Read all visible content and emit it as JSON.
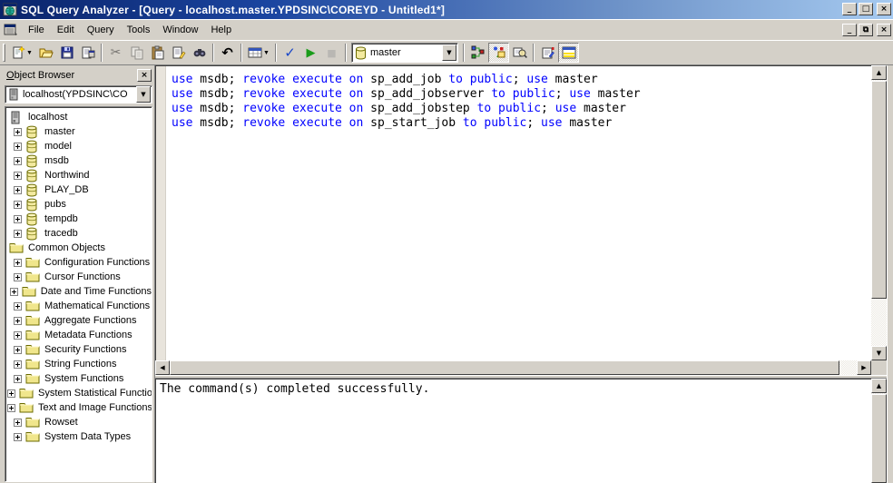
{
  "window": {
    "title": "SQL Query Analyzer - [Query - localhost.master.YPDSINC\\COREYD - Untitled1*]",
    "controls": {
      "minimize": "_",
      "maximize": "□",
      "close": "×",
      "restore": "⧉"
    }
  },
  "menu": {
    "items": [
      "File",
      "Edit",
      "Query",
      "Tools",
      "Window",
      "Help"
    ]
  },
  "toolbar": {
    "buttons": [
      {
        "name": "new-query",
        "dropdown": true,
        "disabled": false,
        "pressed": false
      },
      {
        "name": "open",
        "disabled": false,
        "pressed": false
      },
      {
        "name": "save",
        "disabled": false,
        "pressed": false
      },
      {
        "name": "insert-template",
        "disabled": false,
        "pressed": false
      },
      {
        "name": "sep"
      },
      {
        "name": "cut",
        "disabled": true,
        "pressed": false
      },
      {
        "name": "copy",
        "disabled": true,
        "pressed": false
      },
      {
        "name": "paste",
        "disabled": false,
        "pressed": false
      },
      {
        "name": "clear-window",
        "disabled": false,
        "pressed": false
      },
      {
        "name": "find",
        "disabled": false,
        "pressed": false
      },
      {
        "name": "sep"
      },
      {
        "name": "undo",
        "disabled": false,
        "pressed": false
      },
      {
        "name": "sep"
      },
      {
        "name": "execute-mode",
        "dropdown": true,
        "disabled": false,
        "pressed": false
      },
      {
        "name": "sep"
      },
      {
        "name": "parse-query",
        "disabled": false,
        "pressed": false
      },
      {
        "name": "execute",
        "disabled": false,
        "pressed": false
      },
      {
        "name": "stop",
        "disabled": true,
        "pressed": false
      },
      {
        "name": "sep"
      },
      {
        "name": "database-combo"
      },
      {
        "name": "sep"
      },
      {
        "name": "display-plan",
        "disabled": false,
        "pressed": false
      },
      {
        "name": "object-browser",
        "disabled": false,
        "pressed": true
      },
      {
        "name": "object-search",
        "disabled": false,
        "pressed": false
      },
      {
        "name": "sep"
      },
      {
        "name": "connection-properties",
        "disabled": false,
        "pressed": false
      },
      {
        "name": "show-results-pane",
        "disabled": false,
        "pressed": true
      }
    ],
    "database_combo": {
      "value": "master"
    }
  },
  "object_browser": {
    "title": "Object Browser",
    "close_label": "×",
    "connection": "localhost(YPDSINC\\CO",
    "tree": [
      {
        "label": "localhost",
        "icon": "server",
        "level": 0,
        "plus": false
      },
      {
        "label": "master",
        "icon": "database",
        "level": 1,
        "plus": true
      },
      {
        "label": "model",
        "icon": "database",
        "level": 1,
        "plus": true
      },
      {
        "label": "msdb",
        "icon": "database",
        "level": 1,
        "plus": true
      },
      {
        "label": "Northwind",
        "icon": "database",
        "level": 1,
        "plus": true
      },
      {
        "label": "PLAY_DB",
        "icon": "database",
        "level": 1,
        "plus": true
      },
      {
        "label": "pubs",
        "icon": "database",
        "level": 1,
        "plus": true
      },
      {
        "label": "tempdb",
        "icon": "database",
        "level": 1,
        "plus": true
      },
      {
        "label": "tracedb",
        "icon": "database",
        "level": 1,
        "plus": true
      },
      {
        "label": "Common Objects",
        "icon": "folder",
        "level": 0,
        "plus": false
      },
      {
        "label": "Configuration Functions",
        "icon": "folder",
        "level": 1,
        "plus": true
      },
      {
        "label": "Cursor Functions",
        "icon": "folder",
        "level": 1,
        "plus": true
      },
      {
        "label": "Date and Time Functions",
        "icon": "folder",
        "level": 1,
        "plus": true
      },
      {
        "label": "Mathematical Functions",
        "icon": "folder",
        "level": 1,
        "plus": true
      },
      {
        "label": "Aggregate Functions",
        "icon": "folder",
        "level": 1,
        "plus": true
      },
      {
        "label": "Metadata Functions",
        "icon": "folder",
        "level": 1,
        "plus": true
      },
      {
        "label": "Security Functions",
        "icon": "folder",
        "level": 1,
        "plus": true
      },
      {
        "label": "String Functions",
        "icon": "folder",
        "level": 1,
        "plus": true
      },
      {
        "label": "System Functions",
        "icon": "folder",
        "level": 1,
        "plus": true
      },
      {
        "label": "System Statistical Functions",
        "icon": "folder",
        "level": 1,
        "plus": true
      },
      {
        "label": "Text and Image Functions",
        "icon": "folder",
        "level": 1,
        "plus": true
      },
      {
        "label": "Rowset",
        "icon": "folder",
        "level": 1,
        "plus": true
      },
      {
        "label": "System Data Types",
        "icon": "folder",
        "level": 1,
        "plus": true
      }
    ]
  },
  "editor": {
    "lines": [
      [
        [
          "use",
          "k"
        ],
        [
          " msdb; ",
          "p"
        ],
        [
          "revoke execute on",
          "k"
        ],
        [
          " sp_add_job ",
          "p"
        ],
        [
          "to public",
          "k"
        ],
        [
          "; ",
          "p"
        ],
        [
          "use",
          "k"
        ],
        [
          " master",
          "p"
        ]
      ],
      [
        [
          "use",
          "k"
        ],
        [
          " msdb; ",
          "p"
        ],
        [
          "revoke execute on",
          "k"
        ],
        [
          " sp_add_jobserver ",
          "p"
        ],
        [
          "to public",
          "k"
        ],
        [
          "; ",
          "p"
        ],
        [
          "use",
          "k"
        ],
        [
          " master",
          "p"
        ]
      ],
      [
        [
          "use",
          "k"
        ],
        [
          " msdb; ",
          "p"
        ],
        [
          "revoke execute on",
          "k"
        ],
        [
          " sp_add_jobstep ",
          "p"
        ],
        [
          "to public",
          "k"
        ],
        [
          "; ",
          "p"
        ],
        [
          "use",
          "k"
        ],
        [
          " master",
          "p"
        ]
      ],
      [
        [
          "use",
          "k"
        ],
        [
          " msdb; ",
          "p"
        ],
        [
          "revoke execute on",
          "k"
        ],
        [
          " sp_start_job ",
          "p"
        ],
        [
          "to public",
          "k"
        ],
        [
          "; ",
          "p"
        ],
        [
          "use",
          "k"
        ],
        [
          " master",
          "p"
        ]
      ]
    ]
  },
  "results": {
    "message": "The command(s) completed successfully."
  },
  "colors": {
    "keyword_blue": "#0000ff",
    "title_gradient_left": "#0a246a",
    "title_gradient_right": "#a6caf0",
    "chrome_gray": "#d4d0c8",
    "db_icon_yellow": "#f3eaa0",
    "folder_yellow": "#f0e68c"
  }
}
